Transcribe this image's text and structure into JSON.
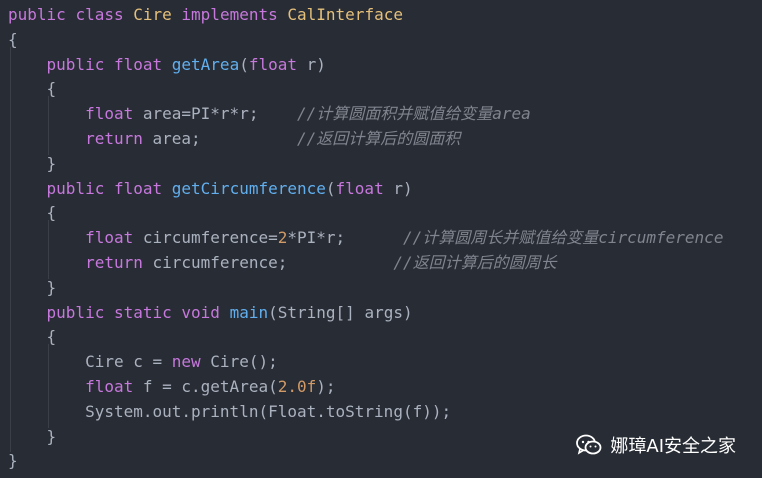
{
  "code_lines": [
    [
      {
        "t": "kw",
        "v": "public "
      },
      {
        "t": "kw",
        "v": "class "
      },
      {
        "t": "cls",
        "v": "Cire "
      },
      {
        "t": "kw",
        "v": "implements "
      },
      {
        "t": "cls",
        "v": "CalInterface"
      }
    ],
    [
      {
        "t": "pl",
        "v": "{"
      }
    ],
    [
      {
        "t": "pl",
        "v": "    "
      },
      {
        "t": "kw",
        "v": "public "
      },
      {
        "t": "kw",
        "v": "float "
      },
      {
        "t": "fn",
        "v": "getArea"
      },
      {
        "t": "pl",
        "v": "("
      },
      {
        "t": "kw",
        "v": "float"
      },
      {
        "t": "pl",
        "v": " r)"
      }
    ],
    [
      {
        "t": "pl",
        "v": "    {"
      }
    ],
    [
      {
        "t": "pl",
        "v": "        "
      },
      {
        "t": "kw",
        "v": "float "
      },
      {
        "t": "pl",
        "v": "area=PI*r*r;    "
      },
      {
        "t": "cm",
        "v": "//计算圆面积并赋值给变量area"
      }
    ],
    [
      {
        "t": "pl",
        "v": "        "
      },
      {
        "t": "kw",
        "v": "return "
      },
      {
        "t": "pl",
        "v": "area;          "
      },
      {
        "t": "cm",
        "v": "//返回计算后的圆面积"
      }
    ],
    [
      {
        "t": "pl",
        "v": "    }"
      }
    ],
    [
      {
        "t": "pl",
        "v": "    "
      },
      {
        "t": "kw",
        "v": "public "
      },
      {
        "t": "kw",
        "v": "float "
      },
      {
        "t": "fn",
        "v": "getCircumference"
      },
      {
        "t": "pl",
        "v": "("
      },
      {
        "t": "kw",
        "v": "float"
      },
      {
        "t": "pl",
        "v": " r)"
      }
    ],
    [
      {
        "t": "pl",
        "v": "    {"
      }
    ],
    [
      {
        "t": "pl",
        "v": "        "
      },
      {
        "t": "kw",
        "v": "float "
      },
      {
        "t": "pl",
        "v": "circumference="
      },
      {
        "t": "num",
        "v": "2"
      },
      {
        "t": "pl",
        "v": "*PI*r;      "
      },
      {
        "t": "cm",
        "v": "//计算圆周长并赋值给变量circumference"
      }
    ],
    [
      {
        "t": "pl",
        "v": "        "
      },
      {
        "t": "kw",
        "v": "return "
      },
      {
        "t": "pl",
        "v": "circumference;           "
      },
      {
        "t": "cm",
        "v": "//返回计算后的圆周长"
      }
    ],
    [
      {
        "t": "pl",
        "v": "    }"
      }
    ],
    [
      {
        "t": "pl",
        "v": "    "
      },
      {
        "t": "kw",
        "v": "public "
      },
      {
        "t": "kw",
        "v": "static "
      },
      {
        "t": "kw",
        "v": "void "
      },
      {
        "t": "fn",
        "v": "main"
      },
      {
        "t": "pl",
        "v": "(String[] args)"
      }
    ],
    [
      {
        "t": "pl",
        "v": "    {"
      }
    ],
    [
      {
        "t": "pl",
        "v": "        Cire c = "
      },
      {
        "t": "kw",
        "v": "new "
      },
      {
        "t": "pl",
        "v": "Cire();"
      }
    ],
    [
      {
        "t": "pl",
        "v": "        "
      },
      {
        "t": "kw",
        "v": "float "
      },
      {
        "t": "pl",
        "v": "f = c.getArea("
      },
      {
        "t": "num",
        "v": "2.0f"
      },
      {
        "t": "pl",
        "v": ");"
      }
    ],
    [
      {
        "t": "pl",
        "v": "        System.out.println(Float.toString(f));"
      }
    ],
    [
      {
        "t": "pl",
        "v": "    }"
      }
    ],
    [
      {
        "t": "pl",
        "v": "}"
      }
    ]
  ],
  "watermark": {
    "icon": "wechat-icon",
    "text": "娜璋AI安全之家"
  },
  "colors": {
    "background": "#282c34",
    "keyword": "#c678dd",
    "class_name": "#e5c07b",
    "function": "#61afef",
    "number": "#d19a66",
    "comment": "#7f848e",
    "plain": "#abb2bf"
  }
}
